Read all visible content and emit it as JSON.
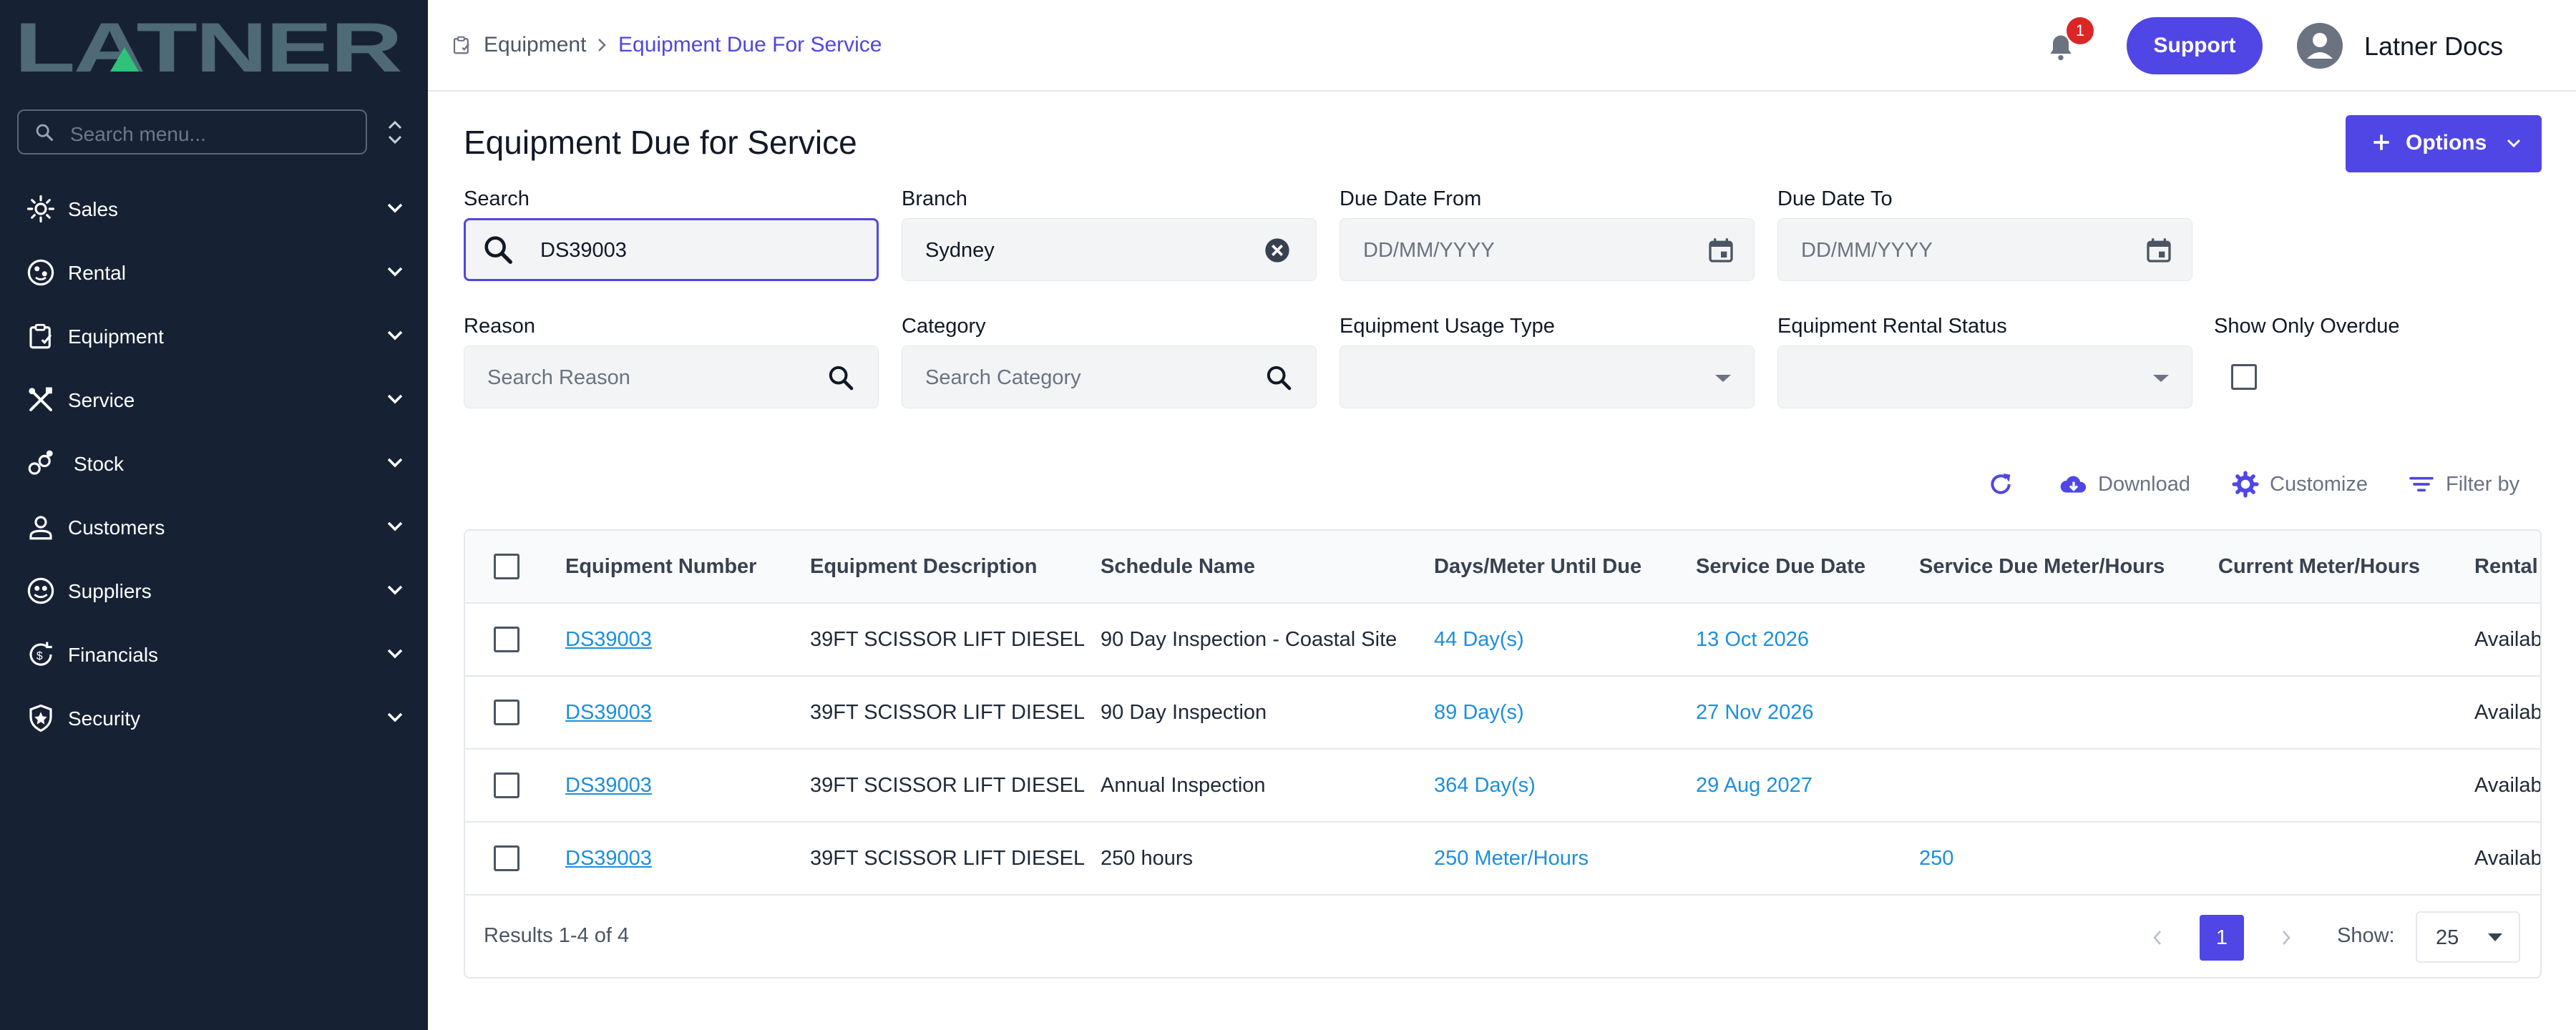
{
  "brand": {
    "logo_text": "LATNER"
  },
  "sidebar": {
    "search_placeholder": "Search menu...",
    "items": [
      {
        "label": "Sales",
        "icon": "sales-icon"
      },
      {
        "label": "Rental",
        "icon": "rental-icon"
      },
      {
        "label": "Equipment",
        "icon": "equipment-icon"
      },
      {
        "label": "Service",
        "icon": "service-icon"
      },
      {
        "label": "Stock",
        "icon": "stock-icon"
      },
      {
        "label": "Customers",
        "icon": "customers-icon"
      },
      {
        "label": "Suppliers",
        "icon": "suppliers-icon"
      },
      {
        "label": "Financials",
        "icon": "financials-icon"
      },
      {
        "label": "Security",
        "icon": "security-icon"
      }
    ]
  },
  "header": {
    "breadcrumb": [
      "Equipment",
      "Equipment Due For Service"
    ],
    "notification_count": "1",
    "support_label": "Support",
    "user_name": "Latner Docs"
  },
  "main": {
    "title": "Equipment Due for Service",
    "options_label": "Options",
    "filters": {
      "search": {
        "label": "Search",
        "value": "DS39003"
      },
      "branch": {
        "label": "Branch",
        "value": "Sydney"
      },
      "due_from": {
        "label": "Due Date From",
        "placeholder": "DD/MM/YYYY"
      },
      "due_to": {
        "label": "Due Date To",
        "placeholder": "DD/MM/YYYY"
      },
      "reason": {
        "label": "Reason",
        "placeholder": "Search Reason"
      },
      "category": {
        "label": "Category",
        "placeholder": "Search Category"
      },
      "usage_type": {
        "label": "Equipment Usage Type",
        "value": ""
      },
      "rental_status": {
        "label": "Equipment Rental Status",
        "value": ""
      },
      "overdue": {
        "label": "Show Only Overdue",
        "checked": false
      }
    },
    "toolbar": {
      "download": "Download",
      "customize": "Customize",
      "filter_by": "Filter by"
    },
    "table": {
      "columns": [
        "Equipment Number",
        "Equipment Description",
        "Schedule Name",
        "Days/Meter Until Due",
        "Service Due Date",
        "Service Due Meter/Hours",
        "Current Meter/Hours",
        "Rental"
      ],
      "rows": [
        {
          "number": "DS39003",
          "description": "39FT SCISSOR LIFT DIESEL",
          "schedule": "90 Day Inspection - Coastal Site",
          "until_due": "44 Day(s)",
          "due_date": "13 Oct 2026",
          "due_meter": "",
          "current_meter": "",
          "rental": "Availab"
        },
        {
          "number": "DS39003",
          "description": "39FT SCISSOR LIFT DIESEL",
          "schedule": "90 Day Inspection",
          "until_due": "89 Day(s)",
          "due_date": "27 Nov 2026",
          "due_meter": "",
          "current_meter": "",
          "rental": "Availab"
        },
        {
          "number": "DS39003",
          "description": "39FT SCISSOR LIFT DIESEL",
          "schedule": "Annual Inspection",
          "until_due": "364 Day(s)",
          "due_date": "29 Aug 2027",
          "due_meter": "",
          "current_meter": "",
          "rental": "Availab"
        },
        {
          "number": "DS39003",
          "description": "39FT SCISSOR LIFT DIESEL",
          "schedule": "250 hours",
          "until_due": "250 Meter/Hours",
          "due_date": "",
          "due_meter": "250",
          "current_meter": "",
          "rental": "Availab"
        }
      ]
    },
    "pagination": {
      "results_text": "Results 1-4 of 4",
      "current_page": "1",
      "show_label": "Show:",
      "page_size": "25"
    }
  },
  "colors": {
    "sidebar_bg": "#172134",
    "accent": "#4f46e5",
    "link": "#1d8fdc",
    "badge": "#dc2626"
  }
}
